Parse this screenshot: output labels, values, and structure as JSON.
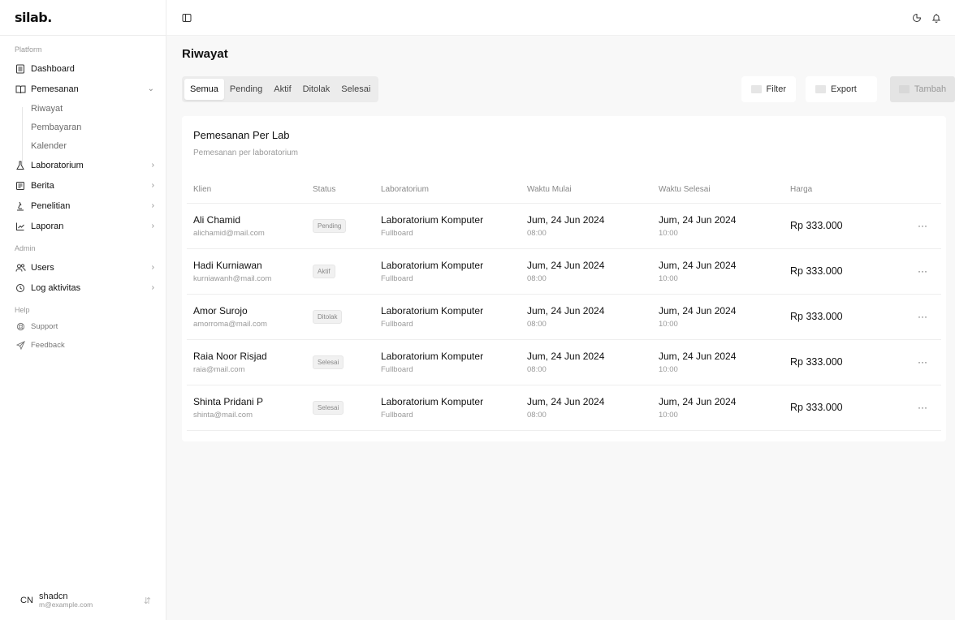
{
  "app": {
    "logo": "silab."
  },
  "sidebar": {
    "section_platform": "Platform",
    "dashboard": "Dashboard",
    "pemesanan": "Pemesanan",
    "sub": [
      "Riwayat",
      "Pembayaran",
      "Kalender"
    ],
    "laboratorium": "Laboratorium",
    "berita": "Berita",
    "penelitian": "Penelitian",
    "laporan": "Laporan",
    "section_admin": "Admin",
    "users": "Users",
    "log": "Log aktivitas",
    "section_help": "Help",
    "support": "Support",
    "feedback": "Feedback",
    "user": {
      "initials": "CN",
      "name": "shadcn",
      "email": "m@example.com"
    }
  },
  "page": {
    "title": "Riwayat"
  },
  "tabs": [
    "Semua",
    "Pending",
    "Aktif",
    "Ditolak",
    "Selesai"
  ],
  "actions": {
    "filter": "Filter",
    "export": "Export",
    "add": "Tambah"
  },
  "card": {
    "title": "Pemesanan Per Lab",
    "subtitle": "Pemesanan per laboratorium"
  },
  "table": {
    "headers": [
      "Klien",
      "Status",
      "Laboratorium",
      "Waktu Mulai",
      "Waktu Selesai",
      "Harga"
    ],
    "rows": [
      {
        "name": "Ali Chamid",
        "email": "alichamid@mail.com",
        "status": "Pending",
        "lab": "Laboratorium Komputer",
        "lab_sub": "Fullboard",
        "start_date": "Jum, 24 Jun 2024",
        "start_time": "08:00",
        "end_date": "Jum, 24 Jun 2024",
        "end_time": "10:00",
        "price": "Rp 333.000"
      },
      {
        "name": "Hadi Kurniawan",
        "email": "kurniawanh@mail.com",
        "status": "Aktif",
        "lab": "Laboratorium Komputer",
        "lab_sub": "Fullboard",
        "start_date": "Jum, 24 Jun 2024",
        "start_time": "08:00",
        "end_date": "Jum, 24 Jun 2024",
        "end_time": "10:00",
        "price": "Rp 333.000"
      },
      {
        "name": "Amor Surojo",
        "email": "amorroma@mail.com",
        "status": "Ditolak",
        "lab": "Laboratorium Komputer",
        "lab_sub": "Fullboard",
        "start_date": "Jum, 24 Jun 2024",
        "start_time": "08:00",
        "end_date": "Jum, 24 Jun 2024",
        "end_time": "10:00",
        "price": "Rp 333.000"
      },
      {
        "name": "Raia Noor Risjad",
        "email": "raia@mail.com",
        "status": "Selesai",
        "lab": "Laboratorium Komputer",
        "lab_sub": "Fullboard",
        "start_date": "Jum, 24 Jun 2024",
        "start_time": "08:00",
        "end_date": "Jum, 24 Jun 2024",
        "end_time": "10:00",
        "price": "Rp 333.000"
      },
      {
        "name": "Shinta Pridani P",
        "email": "shinta@mail.com",
        "status": "Selesai",
        "lab": "Laboratorium Komputer",
        "lab_sub": "Fullboard",
        "start_date": "Jum, 24 Jun 2024",
        "start_time": "08:00",
        "end_date": "Jum, 24 Jun 2024",
        "end_time": "10:00",
        "price": "Rp 333.000"
      }
    ],
    "more_label": "···"
  }
}
